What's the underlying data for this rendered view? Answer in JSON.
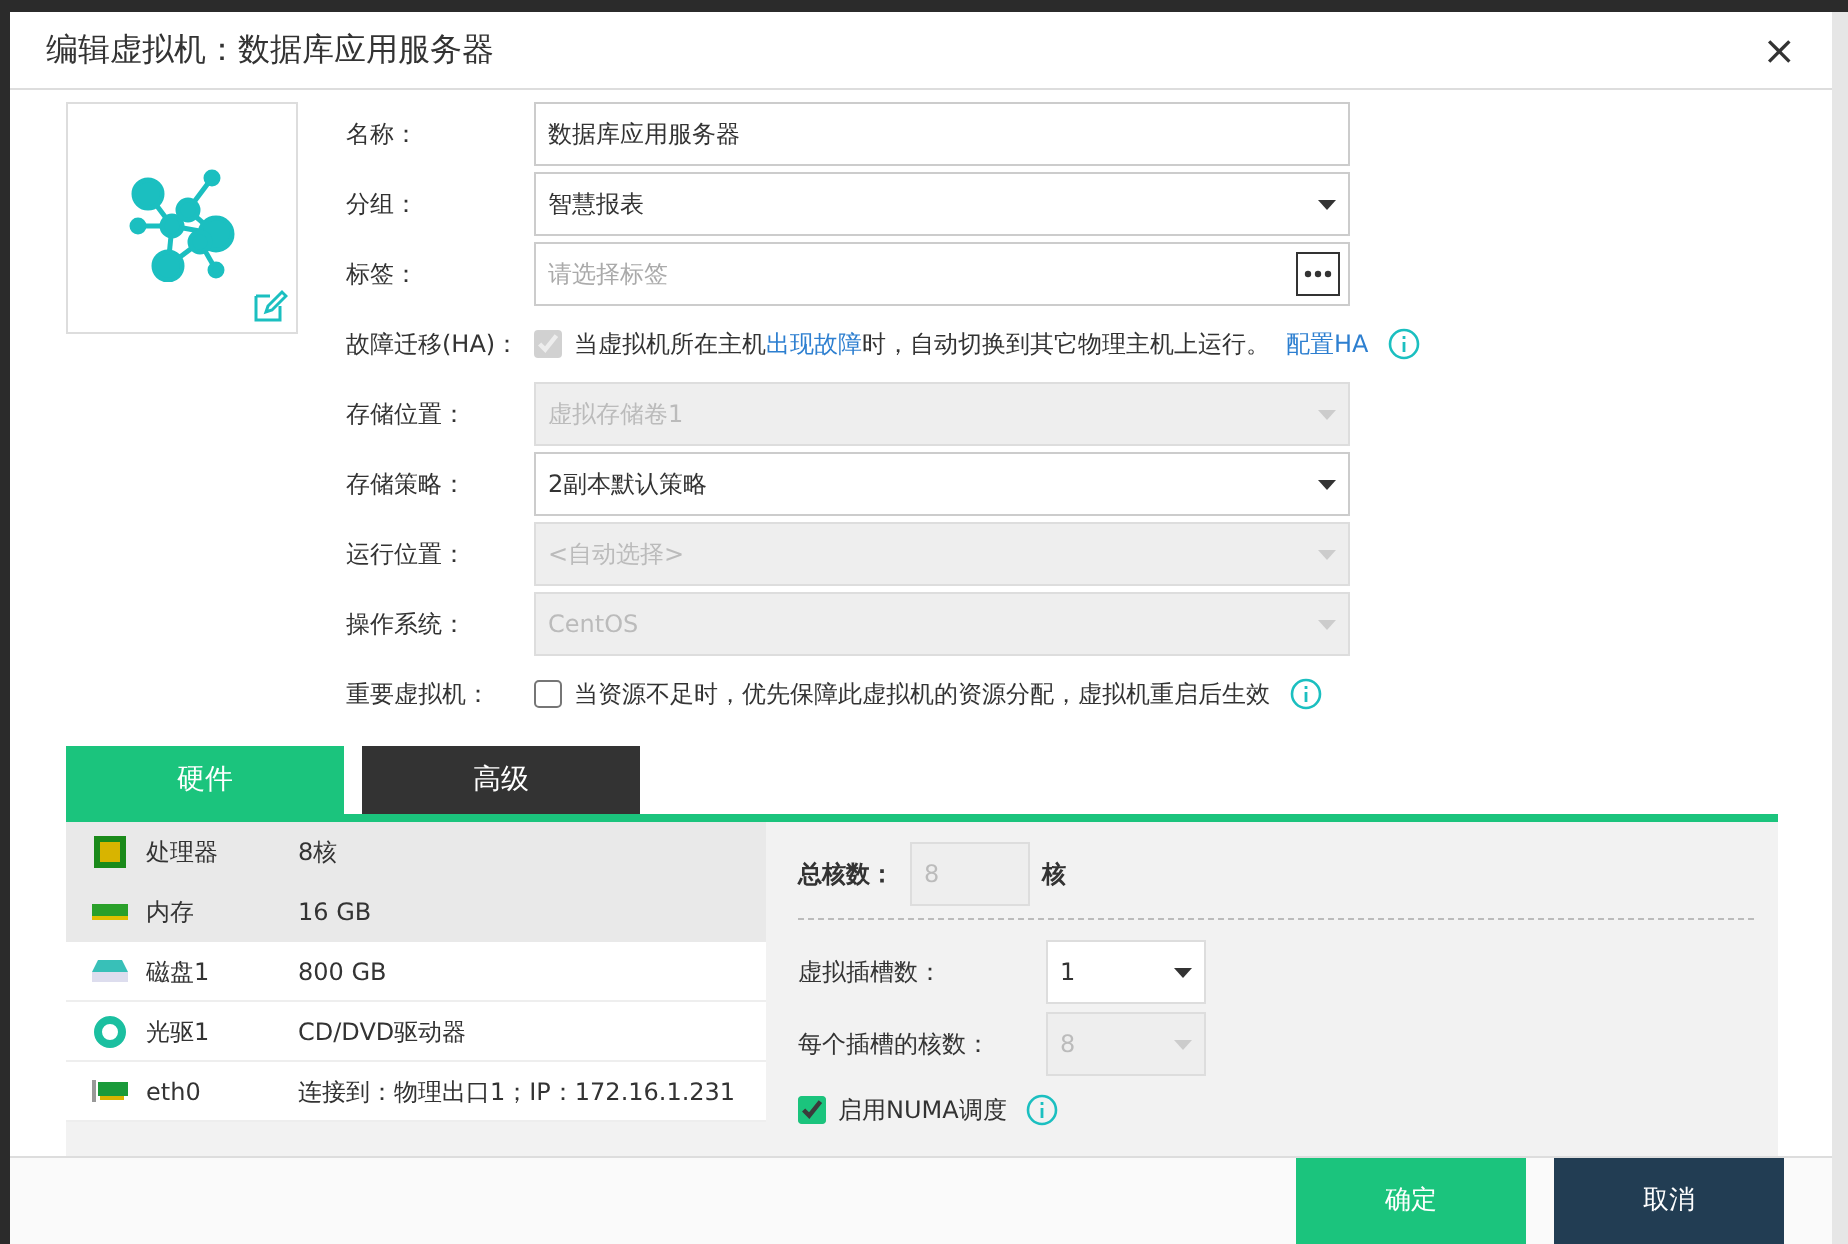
{
  "dialog": {
    "title": "编辑虚拟机：数据库应用服务器",
    "close": "×"
  },
  "form": [
    {
      "kind": "text",
      "label": "名称：",
      "value": "数据库应用服务器",
      "disabled": false
    },
    {
      "kind": "select",
      "label": "分组：",
      "value": "智慧报表",
      "disabled": false
    },
    {
      "kind": "picker",
      "label": "标签：",
      "placeholder": "请选择标签"
    },
    {
      "kind": "checkbox",
      "label": "故障迁移(HA)：",
      "checked": true,
      "disabled": true,
      "segments": [
        {
          "text": "当虚拟机所在主机",
          "link": false
        },
        {
          "text": "出现故障",
          "link": true
        },
        {
          "text": "时，自动切换到其它物理主机上运行。",
          "link": false
        }
      ],
      "action": "配置HA",
      "info": true
    },
    {
      "kind": "select",
      "label": "存储位置：",
      "value": "虚拟存储卷1",
      "disabled": true
    },
    {
      "kind": "select",
      "label": "存储策略：",
      "value": "2副本默认策略",
      "disabled": false
    },
    {
      "kind": "select",
      "label": "运行位置：",
      "value": "<自动选择>",
      "disabled": true
    },
    {
      "kind": "select",
      "label": "操作系统：",
      "value": "CentOS",
      "disabled": true
    },
    {
      "kind": "checkbox",
      "label": "重要虚拟机：",
      "checked": false,
      "disabled": false,
      "segments": [
        {
          "text": "当资源不足时，优先保障此虚拟机的资源分配，虚拟机重启后生效",
          "link": false
        }
      ],
      "info": true
    }
  ],
  "tabs": [
    {
      "label": "硬件",
      "selected": true
    },
    {
      "label": "高级",
      "selected": false
    }
  ],
  "hardware": [
    {
      "kind": "cpu",
      "name": "处理器",
      "value": "8核",
      "selected": true
    },
    {
      "kind": "memory",
      "name": "内存",
      "value": "16 GB",
      "selected": true
    },
    {
      "kind": "disk",
      "name": "磁盘1",
      "value": "800 GB",
      "selected": false
    },
    {
      "kind": "optical",
      "name": "光驱1",
      "value": "CD/DVD驱动器",
      "selected": false
    },
    {
      "kind": "nic",
      "name": "eth0",
      "value": "连接到：物理出口1；IP：172.16.1.231",
      "selected": false
    }
  ],
  "cpu_config": {
    "total_label": "总核数：",
    "total_value": "8",
    "total_unit": "核",
    "sockets_label": "虚拟插槽数：",
    "sockets_value": "1",
    "sockets_disabled": false,
    "per_socket_label": "每个插槽的核数：",
    "per_socket_value": "8",
    "per_socket_disabled": true,
    "numa_label": "启用NUMA调度",
    "numa_checked": true
  },
  "buttons": [
    {
      "label": "确定",
      "kind": "primary"
    },
    {
      "label": "取消",
      "kind": "secondary"
    }
  ]
}
